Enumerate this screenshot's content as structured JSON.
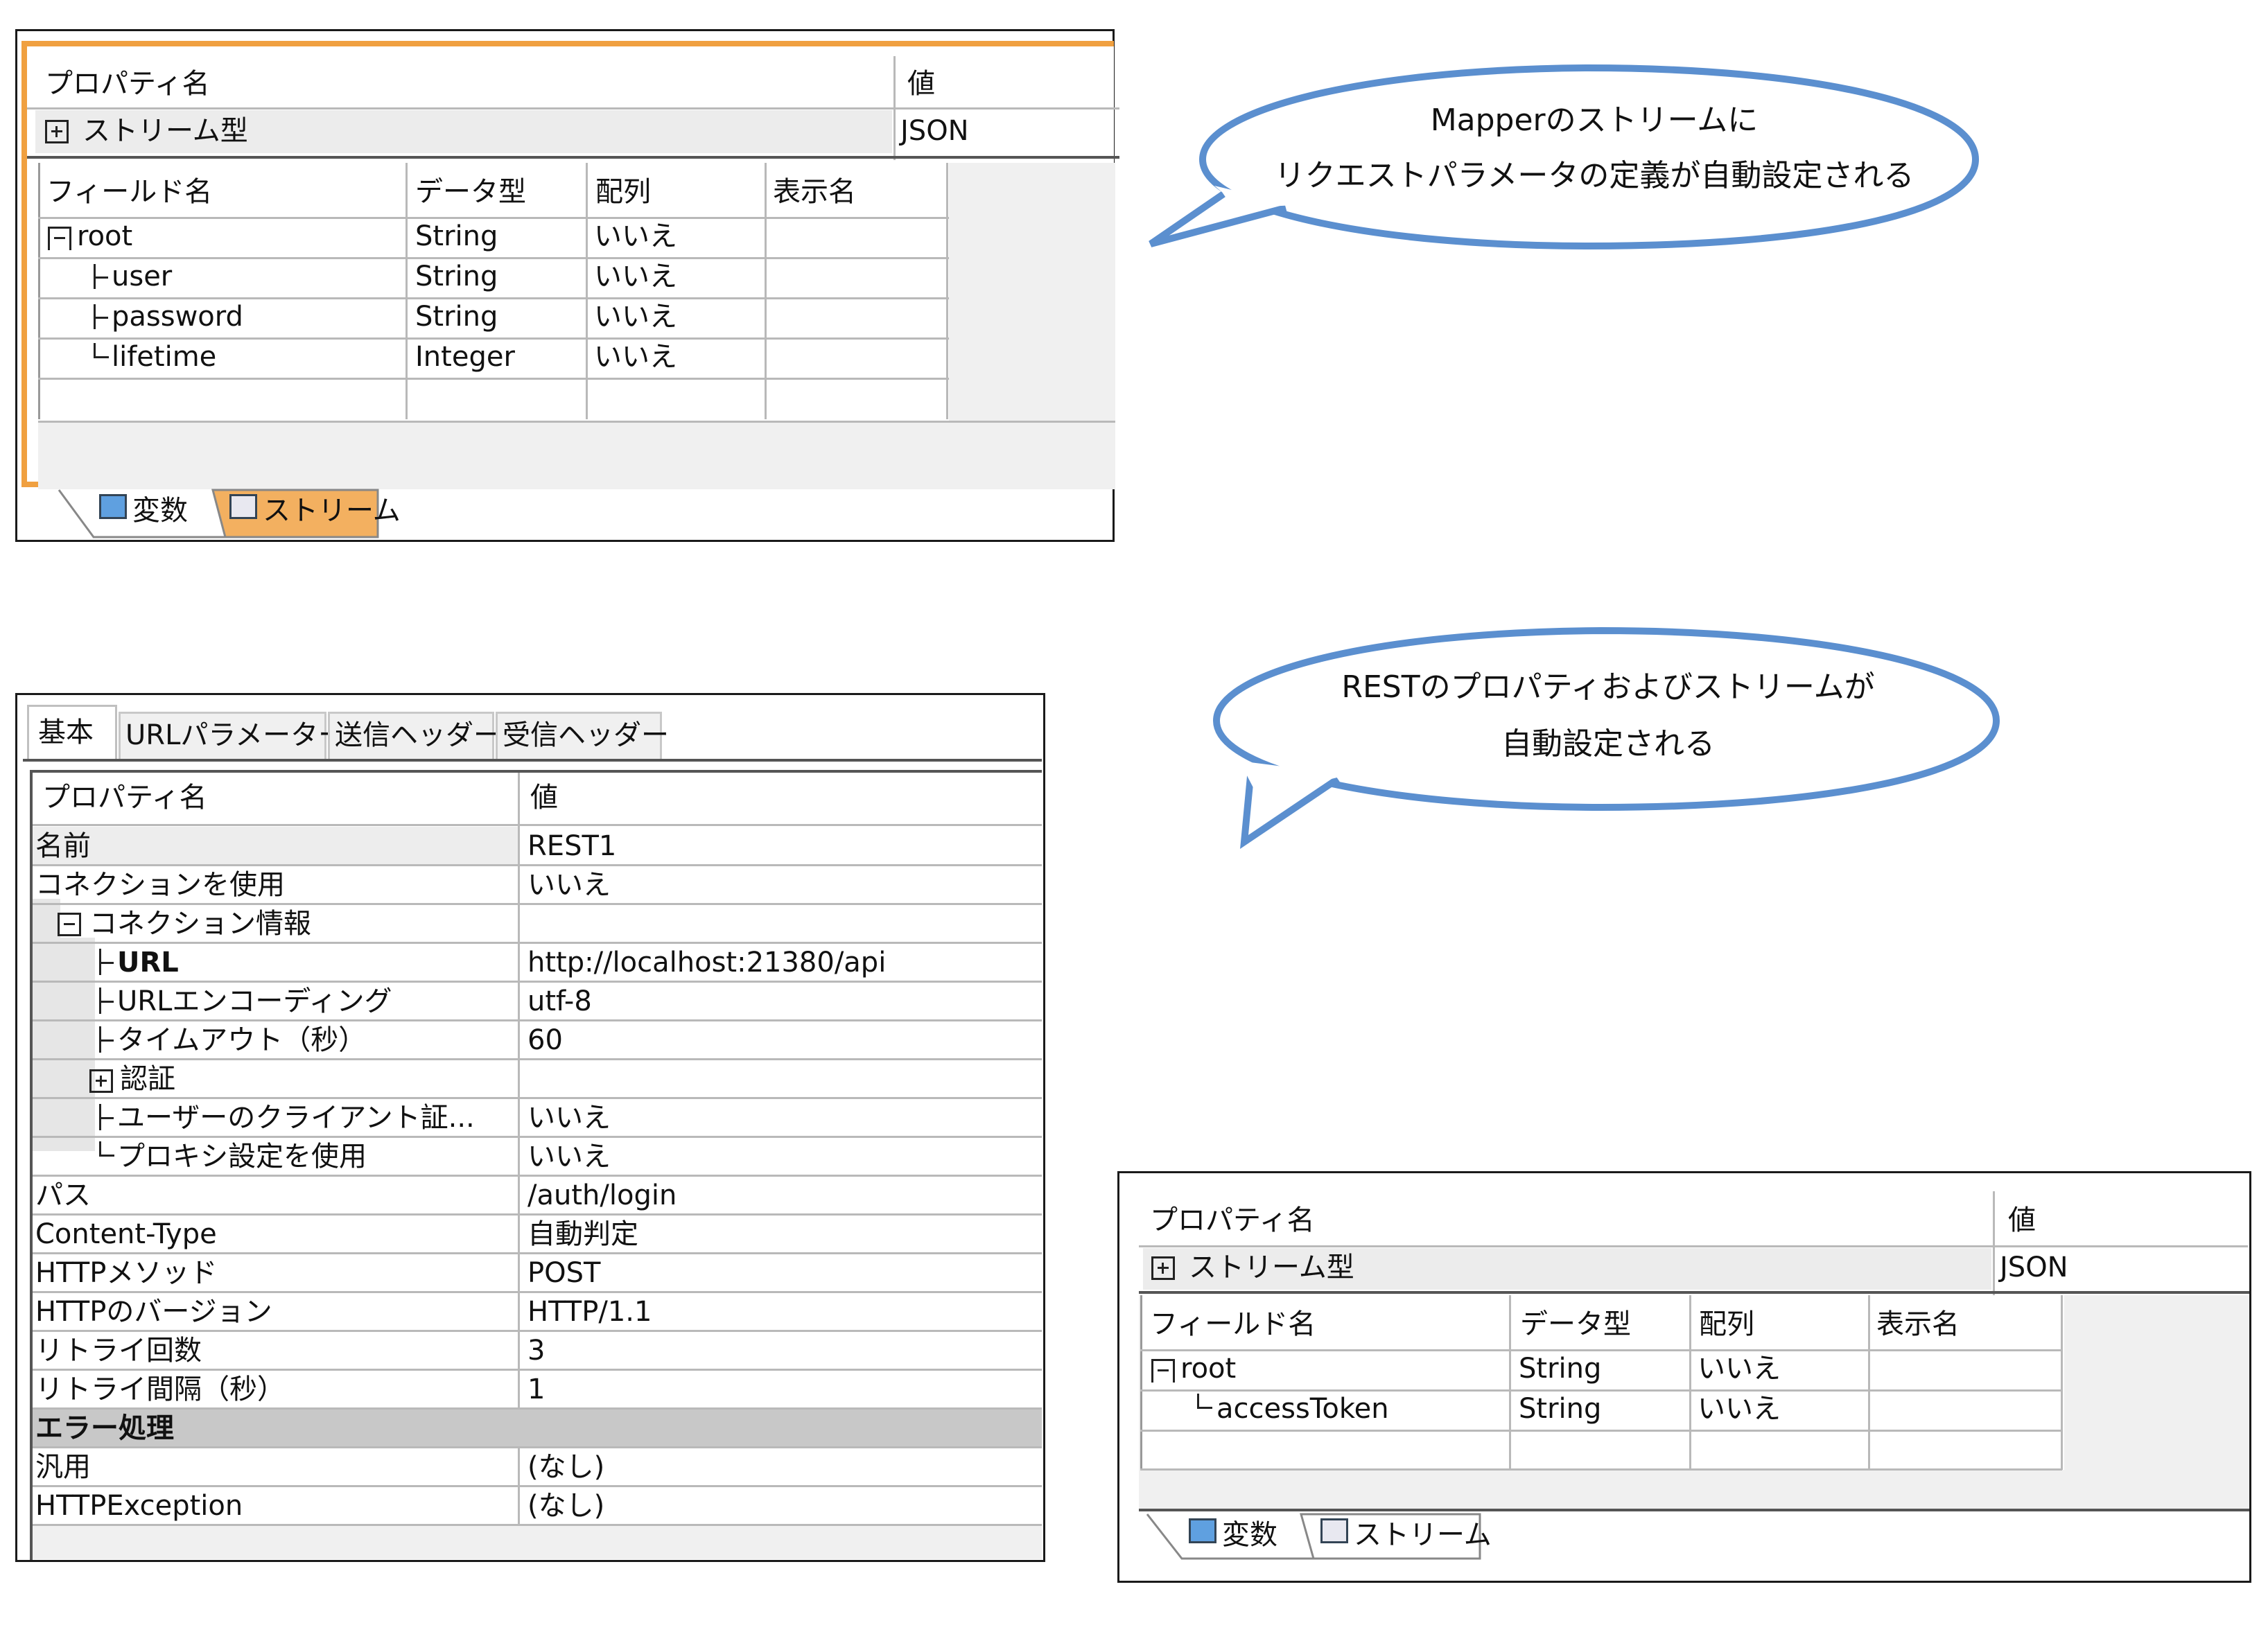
{
  "callout1": {
    "line1": "Mapperのストリームに",
    "line2": "リクエストパラメータの定義が自動設定される"
  },
  "callout2": {
    "line1": "RESTのプロパティおよびストリームが",
    "line2": "自動設定される"
  },
  "stream_panel_1": {
    "prop_header": "プロパティ名",
    "value_header": "値",
    "stream_type_label": "ストリーム型",
    "stream_type_value": "JSON",
    "columns": [
      "フィールド名",
      "データ型",
      "配列",
      "表示名"
    ],
    "rows": [
      {
        "name": "root",
        "type": "String",
        "array": "いいえ",
        "display": ""
      },
      {
        "name": "user",
        "type": "String",
        "array": "いいえ",
        "display": ""
      },
      {
        "name": "password",
        "type": "String",
        "array": "いいえ",
        "display": ""
      },
      {
        "name": "lifetime",
        "type": "Integer",
        "array": "いいえ",
        "display": ""
      }
    ],
    "tabs": [
      "変数",
      "ストリーム"
    ],
    "accent_color": "#f0a040"
  },
  "rest_panel": {
    "tabs": [
      "基本",
      "URLパラメーター",
      "送信ヘッダー",
      "受信ヘッダー"
    ],
    "prop_header": "プロパティ名",
    "value_header": "値",
    "rows": [
      {
        "label": "名前",
        "value": "REST1"
      },
      {
        "label": "コネクションを使用",
        "value": "いいえ"
      },
      {
        "label": "コネクション情報",
        "value": ""
      },
      {
        "label": "URL",
        "value": "http://localhost:21380/api"
      },
      {
        "label": "URLエンコーディング",
        "value": "utf-8"
      },
      {
        "label": "タイムアウト（秒）",
        "value": "60"
      },
      {
        "label": "認証",
        "value": ""
      },
      {
        "label": "ユーザーのクライアント証...",
        "value": "いいえ"
      },
      {
        "label": "プロキシ設定を使用",
        "value": "いいえ"
      },
      {
        "label": "パス",
        "value": "/auth/login"
      },
      {
        "label": "Content-Type",
        "value": "自動判定"
      },
      {
        "label": "HTTPメソッド",
        "value": "POST"
      },
      {
        "label": "HTTPのバージョン",
        "value": "HTTP/1.1"
      },
      {
        "label": "リトライ回数",
        "value": "3"
      },
      {
        "label": "リトライ間隔（秒）",
        "value": "1"
      },
      {
        "label": "エラー処理",
        "value": ""
      },
      {
        "label": "汎用",
        "value": "(なし)"
      },
      {
        "label": "HTTPException",
        "value": "(なし)"
      }
    ]
  },
  "stream_panel_2": {
    "prop_header": "プロパティ名",
    "value_header": "値",
    "stream_type_label": "ストリーム型",
    "stream_type_value": "JSON",
    "columns": [
      "フィールド名",
      "データ型",
      "配列",
      "表示名"
    ],
    "rows": [
      {
        "name": "root",
        "type": "String",
        "array": "いいえ",
        "display": ""
      },
      {
        "name": "accessToken",
        "type": "String",
        "array": "いいえ",
        "display": ""
      }
    ],
    "tabs": [
      "変数",
      "ストリーム"
    ]
  },
  "colors": {
    "callout_border": "#5b8fcf",
    "grid": "#b9b9b9",
    "section_bg": "#c8c8c8",
    "panel_bg": "#f0f0f0"
  }
}
